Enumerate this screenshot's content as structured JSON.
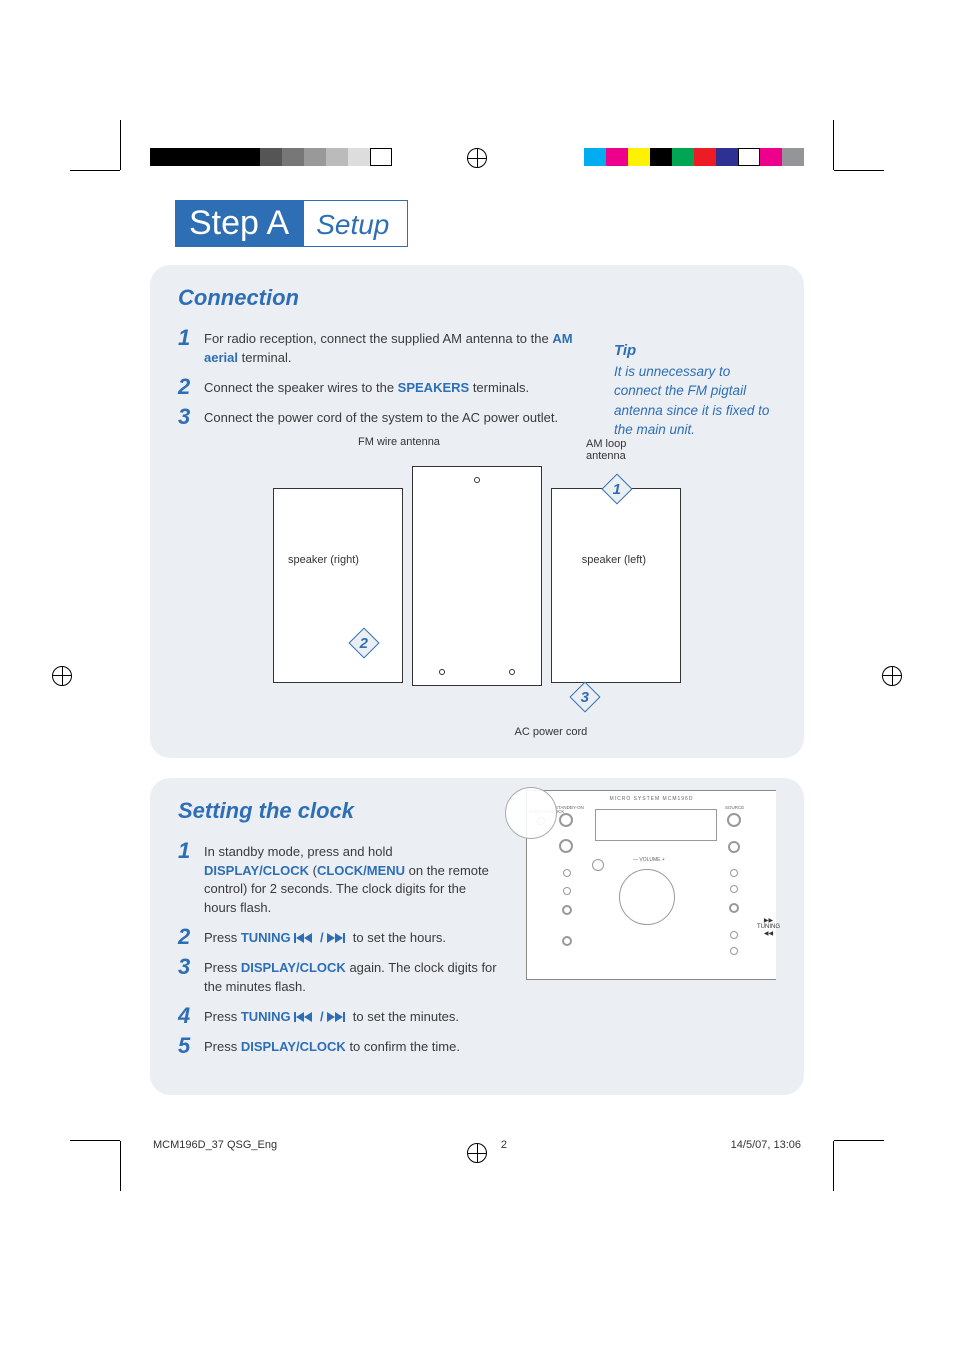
{
  "step_header": {
    "badge": "Step A",
    "title": "Setup"
  },
  "connection": {
    "heading": "Connection",
    "steps": [
      {
        "num": "1",
        "pre": "For radio reception, connect the supplied AM antenna to the ",
        "bold": "AM aerial",
        "post": " terminal."
      },
      {
        "num": "2",
        "pre": "Connect the speaker wires to the ",
        "bold": "SPEAKERS",
        "post": " terminals."
      },
      {
        "num": "3",
        "pre": "Connect the power cord of the system to the AC power outlet.",
        "bold": "",
        "post": ""
      }
    ],
    "tip_title": "Tip",
    "tip_body": "It is unnecessary to connect the FM pigtail antenna since it is fixed to the main unit.",
    "diagram": {
      "fm_antenna": "FM wire antenna",
      "am_antenna": "AM loop antenna",
      "speaker_right": "speaker (right)",
      "speaker_left": "speaker (left)",
      "ac_cord": "AC power cord",
      "callouts": [
        "1",
        "2",
        "3"
      ]
    }
  },
  "clock": {
    "heading": "Setting the clock",
    "steps": [
      {
        "num": "1",
        "pre": "In standby mode, press and hold ",
        "bold": "DISPLAY/CLOCK",
        "post_a": " (",
        "bold2": "CLOCK/MENU",
        "post_b": " on the remote control) for 2 seconds. The clock digits for the hours flash."
      },
      {
        "num": "2",
        "pre": "Press ",
        "bold": "TUNING",
        "icons": true,
        "post": " to set the hours."
      },
      {
        "num": "3",
        "pre": "Press ",
        "bold": "DISPLAY/CLOCK",
        "post_a": " again. The clock digits for the minutes flash."
      },
      {
        "num": "4",
        "pre": "Press ",
        "bold": "TUNING",
        "icons": true,
        "post": " to set the minutes."
      },
      {
        "num": "5",
        "pre": "Press ",
        "bold": "DISPLAY/CLOCK",
        "post_a": " to confirm the time."
      }
    ],
    "device": {
      "model": "MICRO SYSTEM MCM196D",
      "display_clock": "DISPLAY/CLOCK",
      "standby_on": "STANDBY-ON",
      "source": "SOURCE",
      "volume": "VOLUME",
      "tuning": "TUNING",
      "callout": "DISPLAY/CLOCK"
    }
  },
  "footer": {
    "doc": "MCM196D_37 QSG_Eng",
    "page": "2",
    "date": "14/5/07, 13:06"
  },
  "colorbar_left_gray": [
    "#000",
    "#000",
    "#000",
    "#000",
    "#000",
    "#555",
    "#777",
    "#999",
    "#bbb",
    "#ddd",
    "#fff"
  ],
  "colorbar_right": [
    "#00AEEF",
    "#EC008C",
    "#FFF200",
    "#000",
    "#00A651",
    "#ED1C24",
    "#2E3192",
    "#fff",
    "#EC008C",
    "#939598"
  ]
}
